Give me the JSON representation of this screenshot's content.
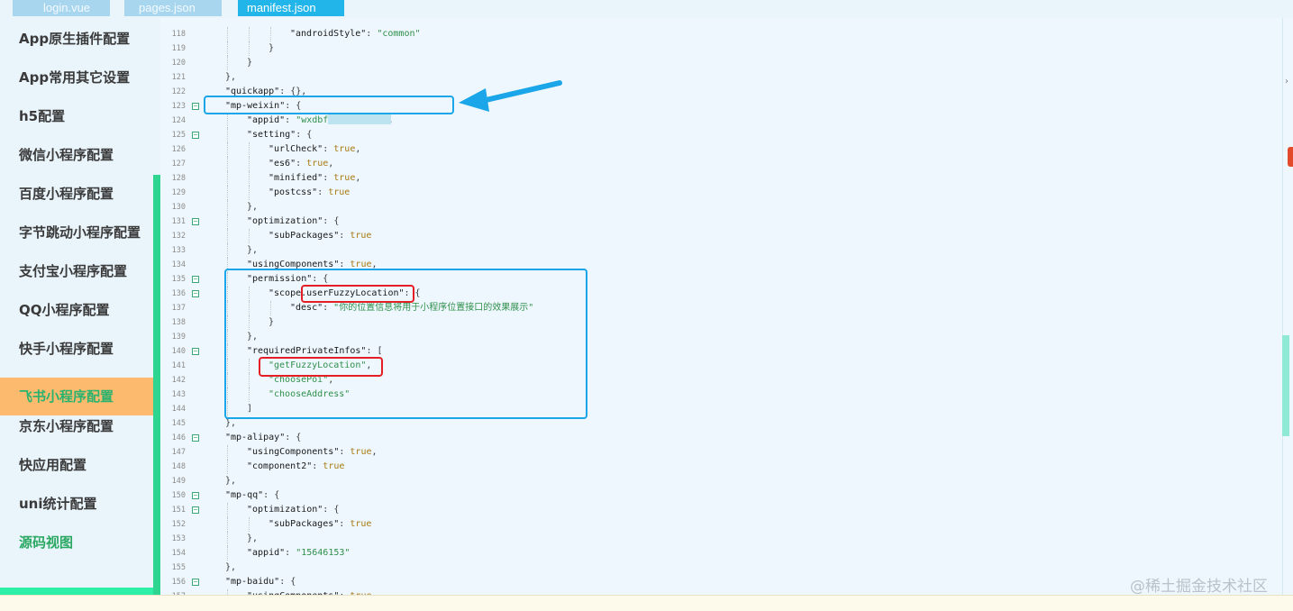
{
  "tabs": [
    "login.vue",
    "pages.json",
    "manifest.json"
  ],
  "sidebar": {
    "items": [
      "App原生插件配置",
      "App常用其它设置",
      "h5配置",
      "微信小程序配置",
      "百度小程序配置",
      "字节跳动小程序配置",
      "支付宝小程序配置",
      "QQ小程序配置",
      "快手小程序配置",
      "飞书小程序配置",
      "京东小程序配置",
      "快应用配置",
      "uni统计配置",
      "源码视图"
    ],
    "active_item": "飞书小程序配置"
  },
  "editor": {
    "lines": [
      {
        "n": "118",
        "indent": 6,
        "fold": false,
        "parts": [
          {
            "t": "\"androidStyle\"",
            "c": "k"
          },
          {
            "t": ": ",
            "c": ""
          },
          {
            "t": "\"common\"",
            "c": "s"
          }
        ]
      },
      {
        "n": "119",
        "indent": 5,
        "fold": false,
        "parts": [
          {
            "t": "}",
            "c": ""
          }
        ]
      },
      {
        "n": "120",
        "indent": 4,
        "fold": false,
        "parts": [
          {
            "t": "}",
            "c": ""
          }
        ]
      },
      {
        "n": "121",
        "indent": 3,
        "fold": false,
        "parts": [
          {
            "t": "},",
            "c": ""
          }
        ]
      },
      {
        "n": "122",
        "indent": 3,
        "fold": false,
        "parts": [
          {
            "t": "\"quickapp\"",
            "c": "k"
          },
          {
            "t": ": {},",
            "c": ""
          }
        ]
      },
      {
        "n": "123",
        "indent": 3,
        "fold": true,
        "parts": [
          {
            "t": "\"mp-weixin\"",
            "c": "k"
          },
          {
            "t": ": {",
            "c": ""
          }
        ]
      },
      {
        "n": "124",
        "indent": 4,
        "fold": false,
        "parts": [
          {
            "t": "\"appid\"",
            "c": "k"
          },
          {
            "t": ": ",
            "c": ""
          },
          {
            "t": "\"wxdbf         6\"",
            "c": "s"
          },
          {
            "t": ",",
            "c": ""
          }
        ]
      },
      {
        "n": "125",
        "indent": 4,
        "fold": true,
        "parts": [
          {
            "t": "\"setting\"",
            "c": "k"
          },
          {
            "t": ": {",
            "c": ""
          }
        ]
      },
      {
        "n": "126",
        "indent": 5,
        "fold": false,
        "parts": [
          {
            "t": "\"urlCheck\"",
            "c": "k"
          },
          {
            "t": ": ",
            "c": ""
          },
          {
            "t": "true",
            "c": "b"
          },
          {
            "t": ",",
            "c": ""
          }
        ]
      },
      {
        "n": "127",
        "indent": 5,
        "fold": false,
        "parts": [
          {
            "t": "\"es6\"",
            "c": "k"
          },
          {
            "t": ": ",
            "c": ""
          },
          {
            "t": "true",
            "c": "b"
          },
          {
            "t": ",",
            "c": ""
          }
        ]
      },
      {
        "n": "128",
        "indent": 5,
        "fold": false,
        "parts": [
          {
            "t": "\"minified\"",
            "c": "k"
          },
          {
            "t": ": ",
            "c": ""
          },
          {
            "t": "true",
            "c": "b"
          },
          {
            "t": ",",
            "c": ""
          }
        ]
      },
      {
        "n": "129",
        "indent": 5,
        "fold": false,
        "parts": [
          {
            "t": "\"postcss\"",
            "c": "k"
          },
          {
            "t": ": ",
            "c": ""
          },
          {
            "t": "true",
            "c": "b"
          }
        ]
      },
      {
        "n": "130",
        "indent": 4,
        "fold": false,
        "parts": [
          {
            "t": "},",
            "c": ""
          }
        ]
      },
      {
        "n": "131",
        "indent": 4,
        "fold": true,
        "parts": [
          {
            "t": "\"optimization\"",
            "c": "k"
          },
          {
            "t": ": {",
            "c": ""
          }
        ]
      },
      {
        "n": "132",
        "indent": 5,
        "fold": false,
        "parts": [
          {
            "t": "\"subPackages\"",
            "c": "k"
          },
          {
            "t": ": ",
            "c": ""
          },
          {
            "t": "true",
            "c": "b"
          }
        ]
      },
      {
        "n": "133",
        "indent": 4,
        "fold": false,
        "parts": [
          {
            "t": "},",
            "c": ""
          }
        ]
      },
      {
        "n": "134",
        "indent": 4,
        "fold": false,
        "parts": [
          {
            "t": "\"usingComponents\"",
            "c": "k"
          },
          {
            "t": ": ",
            "c": ""
          },
          {
            "t": "true",
            "c": "b"
          },
          {
            "t": ",",
            "c": ""
          }
        ]
      },
      {
        "n": "135",
        "indent": 4,
        "fold": true,
        "parts": [
          {
            "t": "\"permission\"",
            "c": "k"
          },
          {
            "t": ": {",
            "c": ""
          }
        ]
      },
      {
        "n": "136",
        "indent": 5,
        "fold": true,
        "parts": [
          {
            "t": "\"scope.userFuzzyLocation\"",
            "c": "k"
          },
          {
            "t": ": {",
            "c": ""
          }
        ]
      },
      {
        "n": "137",
        "indent": 6,
        "fold": false,
        "parts": [
          {
            "t": "\"desc\"",
            "c": "k"
          },
          {
            "t": ": ",
            "c": ""
          },
          {
            "t": "\"你的位置信息将用于小程序位置接口的效果展示\"",
            "c": "s"
          }
        ]
      },
      {
        "n": "138",
        "indent": 5,
        "fold": false,
        "parts": [
          {
            "t": "}",
            "c": ""
          }
        ]
      },
      {
        "n": "139",
        "indent": 4,
        "fold": false,
        "parts": [
          {
            "t": "},",
            "c": ""
          }
        ]
      },
      {
        "n": "140",
        "indent": 4,
        "fold": true,
        "parts": [
          {
            "t": "\"requiredPrivateInfos\"",
            "c": "k"
          },
          {
            "t": ": [",
            "c": ""
          }
        ]
      },
      {
        "n": "141",
        "indent": 5,
        "fold": false,
        "parts": [
          {
            "t": "\"getFuzzyLocation\"",
            "c": "s"
          },
          {
            "t": ",",
            "c": ""
          }
        ]
      },
      {
        "n": "142",
        "indent": 5,
        "fold": false,
        "parts": [
          {
            "t": "\"choosePoi\"",
            "c": "s"
          },
          {
            "t": ",",
            "c": ""
          }
        ]
      },
      {
        "n": "143",
        "indent": 5,
        "fold": false,
        "parts": [
          {
            "t": "\"chooseAddress\"",
            "c": "s"
          }
        ]
      },
      {
        "n": "144",
        "indent": 4,
        "fold": false,
        "parts": [
          {
            "t": "]",
            "c": ""
          }
        ]
      },
      {
        "n": "145",
        "indent": 3,
        "fold": false,
        "parts": [
          {
            "t": "},",
            "c": ""
          }
        ]
      },
      {
        "n": "146",
        "indent": 3,
        "fold": true,
        "parts": [
          {
            "t": "\"mp-alipay\"",
            "c": "k"
          },
          {
            "t": ": {",
            "c": ""
          }
        ]
      },
      {
        "n": "147",
        "indent": 4,
        "fold": false,
        "parts": [
          {
            "t": "\"usingComponents\"",
            "c": "k"
          },
          {
            "t": ": ",
            "c": ""
          },
          {
            "t": "true",
            "c": "b"
          },
          {
            "t": ",",
            "c": ""
          }
        ]
      },
      {
        "n": "148",
        "indent": 4,
        "fold": false,
        "parts": [
          {
            "t": "\"component2\"",
            "c": "k"
          },
          {
            "t": ": ",
            "c": ""
          },
          {
            "t": "true",
            "c": "b"
          }
        ]
      },
      {
        "n": "149",
        "indent": 3,
        "fold": false,
        "parts": [
          {
            "t": "},",
            "c": ""
          }
        ]
      },
      {
        "n": "150",
        "indent": 3,
        "fold": true,
        "parts": [
          {
            "t": "\"mp-qq\"",
            "c": "k"
          },
          {
            "t": ": {",
            "c": ""
          }
        ]
      },
      {
        "n": "151",
        "indent": 4,
        "fold": true,
        "parts": [
          {
            "t": "\"optimization\"",
            "c": "k"
          },
          {
            "t": ": {",
            "c": ""
          }
        ]
      },
      {
        "n": "152",
        "indent": 5,
        "fold": false,
        "parts": [
          {
            "t": "\"subPackages\"",
            "c": "k"
          },
          {
            "t": ": ",
            "c": ""
          },
          {
            "t": "true",
            "c": "b"
          }
        ]
      },
      {
        "n": "153",
        "indent": 4,
        "fold": false,
        "parts": [
          {
            "t": "},",
            "c": ""
          }
        ]
      },
      {
        "n": "154",
        "indent": 4,
        "fold": false,
        "parts": [
          {
            "t": "\"appid\"",
            "c": "k"
          },
          {
            "t": ": ",
            "c": ""
          },
          {
            "t": "\"15646153\"",
            "c": "s"
          }
        ]
      },
      {
        "n": "155",
        "indent": 3,
        "fold": false,
        "parts": [
          {
            "t": "},",
            "c": ""
          }
        ]
      },
      {
        "n": "156",
        "indent": 3,
        "fold": true,
        "parts": [
          {
            "t": "\"mp-baidu\"",
            "c": "k"
          },
          {
            "t": ": {",
            "c": ""
          }
        ]
      },
      {
        "n": "157",
        "indent": 4,
        "fold": false,
        "parts": [
          {
            "t": "\"usingComponents\"",
            "c": "k"
          },
          {
            "t": ": ",
            "c": ""
          },
          {
            "t": "true",
            "c": "b"
          }
        ]
      }
    ]
  },
  "watermark": "@稀土掘金技术社区",
  "colors": {
    "tab_active": "#22b5ea",
    "sidebar_active": "#fbba6d",
    "accent_green": "#2dd590",
    "annotation_blue": "#1aa6e8",
    "annotation_red": "#e51e25"
  },
  "icons": [
    "fold-minus-icon",
    "arrow-annotation-icon"
  ]
}
